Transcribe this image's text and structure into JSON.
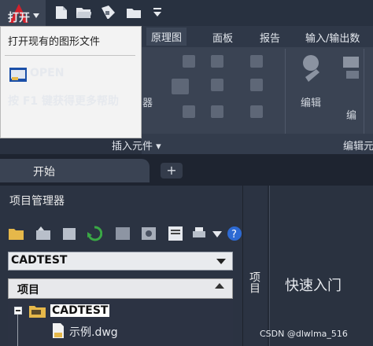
{
  "quick_access": {
    "icons": [
      "app-logo-icon",
      "new-file-icon",
      "open-folder-icon",
      "save-icon",
      "save-as-icon",
      "dropdown-icon"
    ]
  },
  "ribbon": {
    "tabs": [
      {
        "label": "原理图",
        "active": true
      },
      {
        "label": "面板",
        "active": false
      },
      {
        "label": "报告",
        "active": false
      },
      {
        "label": "输入/输出数",
        "active": false
      }
    ],
    "panel_fragments": {
      "left_edge": "器",
      "edit": "编辑",
      "edit2": "编",
      "bottom_left": "插入元件 ▾",
      "bottom_right": "编辑元"
    }
  },
  "tooltip": {
    "title": "打开",
    "description": "打开现有的图形文件",
    "command": "OPEN",
    "help": "按 F1 键获得更多帮助"
  },
  "tabs": {
    "start": "开始",
    "add": "+"
  },
  "project_manager": {
    "title": "项目管理器",
    "selected_project": "CADTEST",
    "list_header": "项目",
    "tree": [
      {
        "label": "CADTEST",
        "bold": true
      },
      {
        "label": "示例.dwg",
        "bold": false
      }
    ]
  },
  "side_tab": {
    "label": "项目"
  },
  "quick_start": {
    "title": "快速入门"
  },
  "watermark": "CSDN @dlwlma_516",
  "colors": {
    "accent_red": "#c8202a",
    "folder_yellow": "#e6b84a",
    "refresh_green": "#3aa845"
  }
}
